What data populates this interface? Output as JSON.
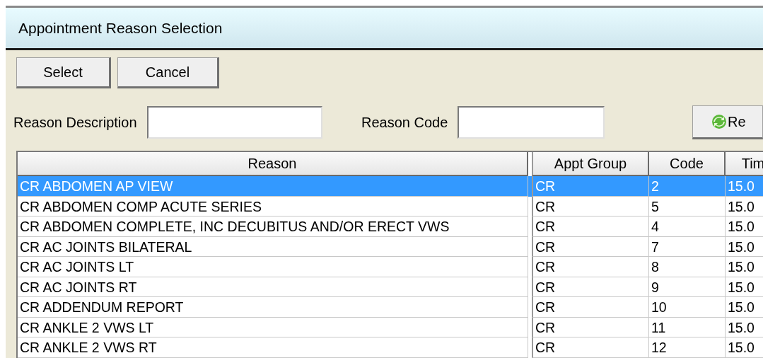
{
  "window": {
    "title": "Appointment Reason Selection"
  },
  "buttons": [
    "Select",
    "Cancel"
  ],
  "filters": [
    {
      "label": "Reason Description"
    },
    {
      "label": "Reason Code"
    }
  ],
  "refresh_button": "Re",
  "table": {
    "columns": [
      "Reason",
      "Appt Group",
      "Code",
      "Tim"
    ],
    "rows": [
      {
        "cells": [
          "CR ABDOMEN AP VIEW",
          "CR",
          "2",
          "15.0"
        ],
        "selected": true
      },
      {
        "cells": [
          "CR ABDOMEN COMP ACUTE SERIES",
          "CR",
          "5",
          "15.0"
        ],
        "selected": false
      },
      {
        "cells": [
          "CR ABDOMEN COMPLETE, INC DECUBITUS AND/OR ERECT VWS",
          "CR",
          "4",
          "15.0"
        ],
        "selected": false
      },
      {
        "cells": [
          "CR AC JOINTS BILATERAL",
          "CR",
          "7",
          "15.0"
        ],
        "selected": false
      },
      {
        "cells": [
          "CR AC JOINTS LT",
          "CR",
          "8",
          "15.0"
        ],
        "selected": false
      },
      {
        "cells": [
          "CR AC JOINTS RT",
          "CR",
          "9",
          "15.0"
        ],
        "selected": false
      },
      {
        "cells": [
          "CR ADDENDUM REPORT",
          "CR",
          "10",
          "15.0"
        ],
        "selected": false
      },
      {
        "cells": [
          "CR ANKLE 2 VWS LT",
          "CR",
          "11",
          "15.0"
        ],
        "selected": false
      },
      {
        "cells": [
          "CR ANKLE 2 VWS RT",
          "CR",
          "12",
          "15.0"
        ],
        "selected": false
      }
    ]
  }
}
